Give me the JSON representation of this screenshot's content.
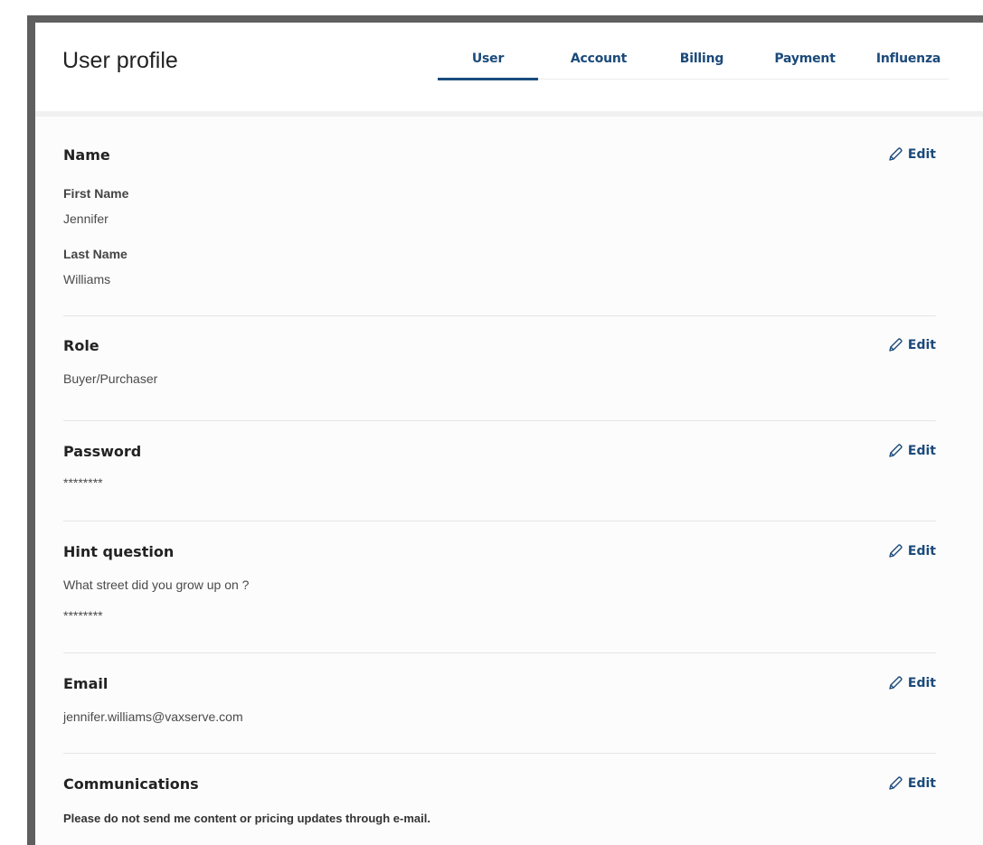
{
  "header": {
    "title": "User profile"
  },
  "tabs": [
    {
      "label": "User",
      "active": true
    },
    {
      "label": "Account",
      "active": false
    },
    {
      "label": "Billing",
      "active": false
    },
    {
      "label": "Payment",
      "active": false
    },
    {
      "label": "Influenza",
      "active": false
    }
  ],
  "edit_label": "Edit",
  "sections": {
    "name": {
      "title": "Name",
      "first_name_label": "First Name",
      "first_name_value": "Jennifer",
      "last_name_label": "Last Name",
      "last_name_value": "Williams"
    },
    "role": {
      "title": "Role",
      "value": "Buyer/Purchaser"
    },
    "password": {
      "title": "Password",
      "value": "********"
    },
    "hint": {
      "title": "Hint question",
      "question": "What street did you grow up on ?",
      "answer": "********"
    },
    "email": {
      "title": "Email",
      "value": "jennifer.williams@vaxserve.com"
    },
    "communications": {
      "title": "Communications",
      "value": "Please do not send me content or pricing updates through e-mail."
    }
  },
  "colors": {
    "accent": "#1b4d7e",
    "frame": "#5f5f5f",
    "text": "#222222"
  },
  "icons": {
    "edit": "pencil-icon"
  }
}
